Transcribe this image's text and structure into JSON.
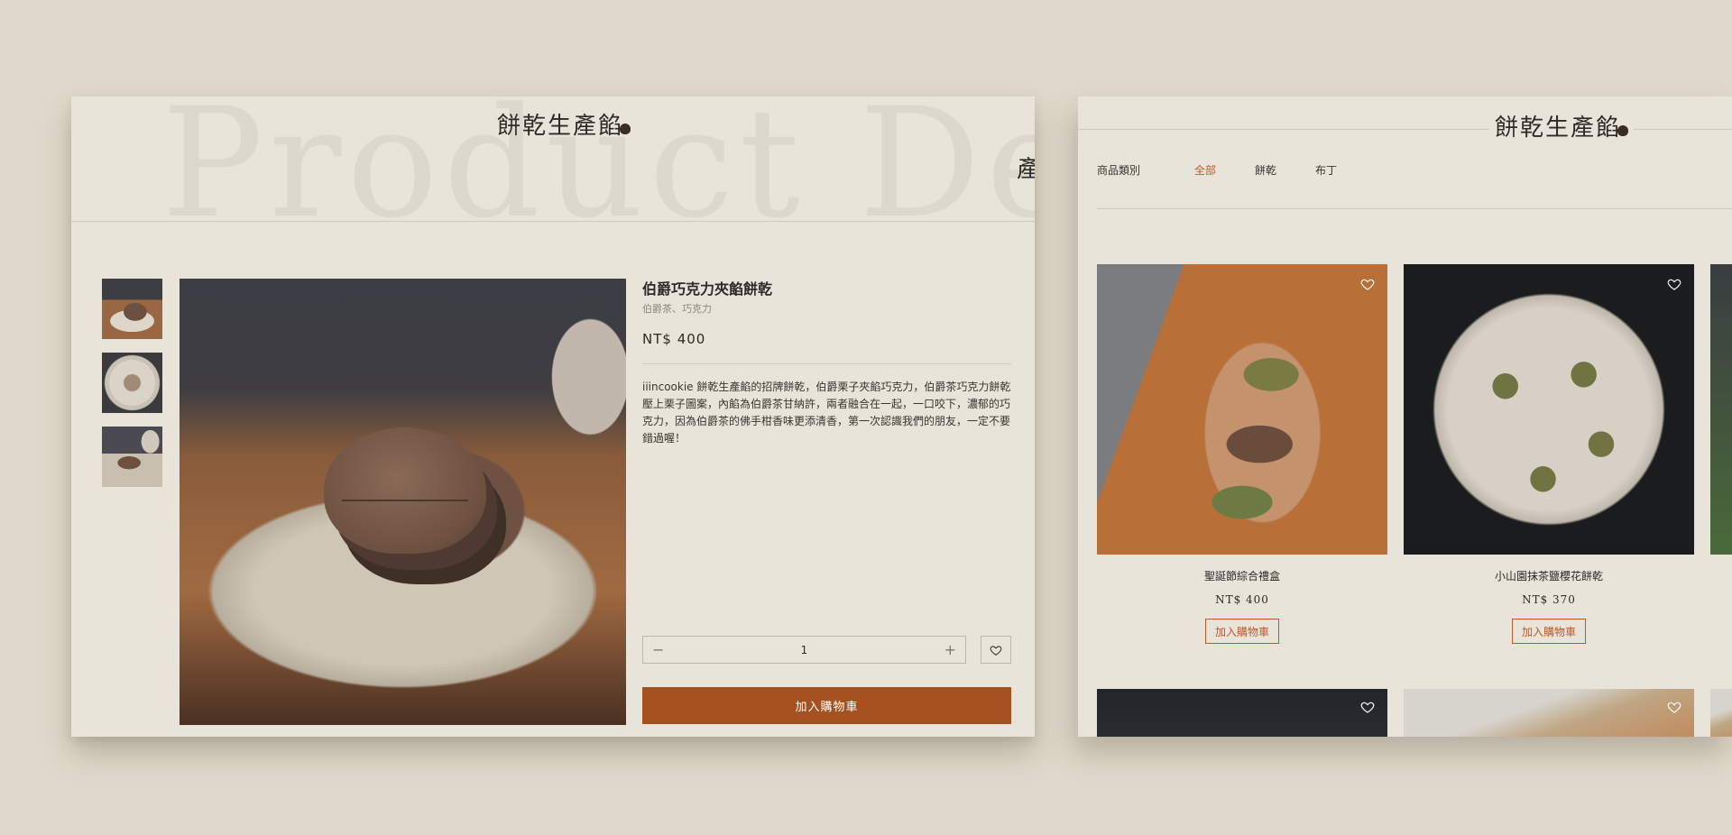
{
  "brand": {
    "logo_text": "餅乾生產餡",
    "edge_char": "產"
  },
  "detail": {
    "watermark": "Product Deta",
    "product_name": "伯爵巧克力夾餡餅乾",
    "flavors": "伯爵茶、巧克力",
    "price": "NT$ 400",
    "description": "iiincookie 餅乾生產餡的招牌餅乾，伯爵栗子夾餡巧克力，伯爵茶巧克力餅乾壓上栗子圖案，內餡為伯爵茶甘納許，兩者融合在一起，一口咬下，濃郁的巧克力，因為伯爵茶的佛手柑香味更添清香，第一次認識我們的朋友，一定不要錯過喔！",
    "quantity": "1",
    "minus": "−",
    "plus": "+",
    "add_to_cart": "加入購物車"
  },
  "listing": {
    "category_label": "商品類別",
    "categories": [
      "全部",
      "餅乾",
      "布丁"
    ],
    "products": [
      {
        "name": "聖誕節綜合禮盒",
        "price": "NT$ 400",
        "button": "加入購物車"
      },
      {
        "name": "小山園抹茶鹽櫻花餅乾",
        "price": "NT$ 370",
        "button": "加入購物車"
      }
    ]
  },
  "colors": {
    "accent": "#a5511f",
    "background": "#e0d9cb",
    "panel": "#e8e4da"
  }
}
